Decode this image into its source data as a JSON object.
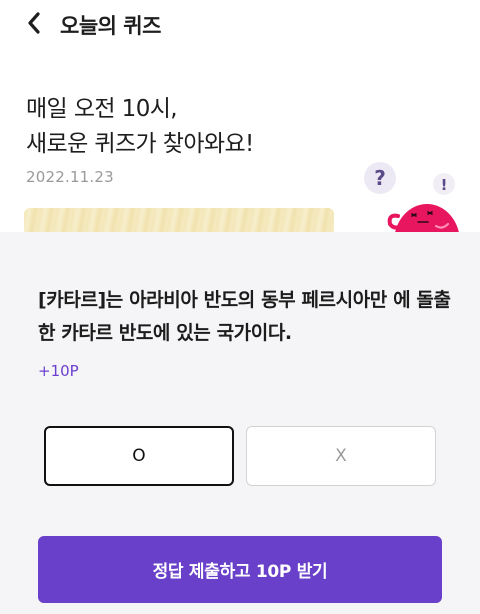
{
  "header": {
    "title": "오늘의 퀴즈",
    "back_icon": "chevron-left-icon"
  },
  "hero": {
    "line1": "매일 오전 10시,",
    "line2": "새로운 퀴즈가 찾아와요!",
    "date": "2022.11.23",
    "mascot_marks": {
      "question": "?",
      "exclaim": "!"
    }
  },
  "quiz": {
    "question": "[카타르]는 아라비아 반도의 동부 페르시아만 에 돌출한 카타르 반도에 있는 국가이다.",
    "points": "+10P",
    "option_o": "O",
    "option_x": "X",
    "submit_label": "정답 제출하고 10P 받기"
  },
  "colors": {
    "accent": "#6940c9",
    "points_text": "#6a3fd0",
    "mascot": "#e8155f",
    "card_bg": "#f5f5f7"
  }
}
